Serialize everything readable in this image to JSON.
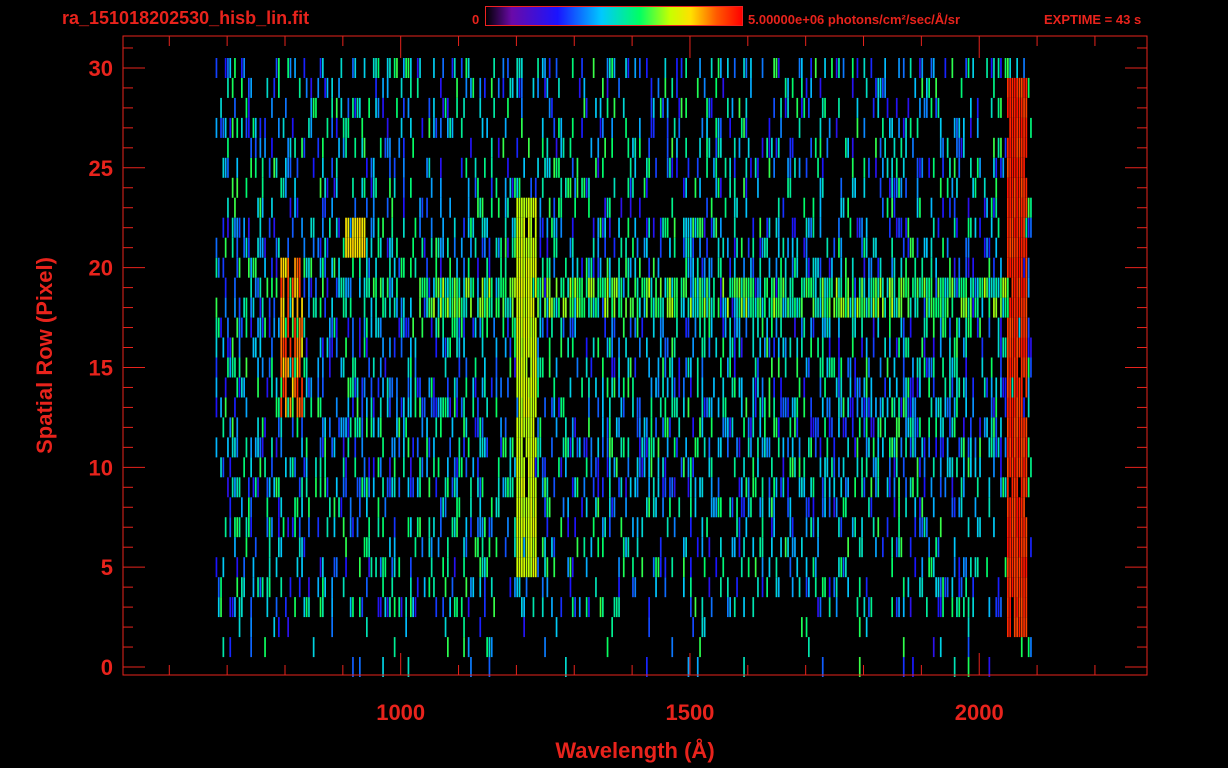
{
  "header": {
    "file_title": "ra_151018202530_hisb_lin.fit",
    "colorbar_min": "0",
    "colorbar_max_units": "5.00000e+06 photons/cm²/sec/Å/sr",
    "exptime": "EXPTIME = 43 s"
  },
  "colors": {
    "axis": "#e8231c",
    "background": "#000000",
    "colormap": [
      "#000000",
      "#6a0aa8",
      "#1a14ff",
      "#00c8ff",
      "#00ff64",
      "#c8ff00",
      "#ffe000",
      "#ff5a00",
      "#ff0000"
    ]
  },
  "chart_data": {
    "type": "heatmap",
    "title": "ra_151018202530_hisb_lin.fit",
    "xlabel": "Wavelength (Å)",
    "ylabel": "Spatial Row (Pixel)",
    "xlim": [
      520,
      2290
    ],
    "ylim": [
      -0.4,
      31.6
    ],
    "xticks": [
      1000,
      1500,
      2000
    ],
    "yticks": [
      0,
      5,
      10,
      15,
      20,
      25,
      30
    ],
    "x_minor_step": 100,
    "y_minor_step": 1,
    "grid": false,
    "colorbar": {
      "min": 0,
      "max": 5000000,
      "units": "photons/cm²/sec/Å/sr",
      "position": "top"
    },
    "exposure_s": 43,
    "data_extent": {
      "wavelength_range": [
        680,
        2090
      ],
      "rows": [
        0,
        30
      ]
    },
    "features": [
      {
        "name": "Lyman-alpha line",
        "wavelength": 1216,
        "rows": [
          5,
          23
        ],
        "level": 0.68
      },
      {
        "name": "bright continuum band",
        "wavelength_range": [
          1030,
          2050
        ],
        "rows": [
          18,
          19
        ],
        "level": 0.62
      },
      {
        "name": "bright feature",
        "wavelength_range": [
          790,
          830
        ],
        "rows": [
          13,
          20
        ],
        "level": 0.95
      },
      {
        "name": "emission feature",
        "wavelength": 920,
        "rows": [
          21,
          22
        ],
        "level": 0.78
      },
      {
        "name": "detector edge",
        "wavelength": 2065,
        "rows": [
          2,
          29
        ],
        "level": 0.98
      }
    ]
  }
}
